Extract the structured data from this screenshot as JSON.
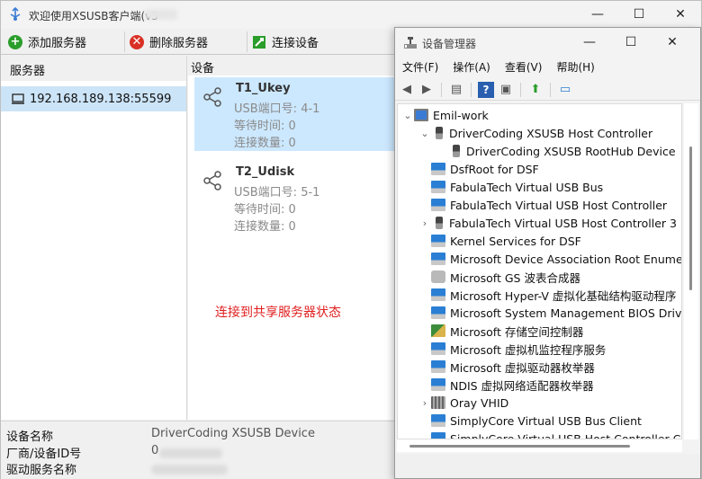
{
  "main": {
    "title": "欢迎使用XSUSB客户端(v3",
    "toolbar": {
      "add_server": "添加服务器",
      "delete_server": "删除服务器",
      "connect_device": "连接设备"
    },
    "servers_header": "服务器",
    "devices_header": "设备",
    "server_item": "192.168.189.138:55599",
    "devices": [
      {
        "name": "T1_Ukey",
        "port": "USB端口号: 4-1",
        "wait": "等待时间: 0",
        "count": "连接数量: 0"
      },
      {
        "name": "T2_Udisk",
        "port": "USB端口号: 5-1",
        "wait": "等待时间: 0",
        "count": "连接数量: 0"
      }
    ],
    "status_message": "连接到共享服务器状态",
    "info": {
      "device_name_label": "设备名称",
      "device_name_value": "DriverCoding XSUSB Device",
      "vendor_label": "厂商/设备ID号",
      "vendor_value": "0",
      "driver_label": "驱动服务名称"
    }
  },
  "devmgr": {
    "title": "设备管理器",
    "menus": [
      "文件(F)",
      "操作(A)",
      "查看(V)",
      "帮助(H)"
    ],
    "tree": [
      {
        "label": "Emil-work",
        "level": 0,
        "expander": "open",
        "icon": "computer-icon"
      },
      {
        "label": "DriverCoding XSUSB Host Controller",
        "level": 1,
        "expander": "open",
        "icon": "usb-plug-icon"
      },
      {
        "label": "DriverCoding XSUSB RootHub Device",
        "level": 2,
        "expander": "none",
        "icon": "usb-plug-icon"
      },
      {
        "label": "DsfRoot for DSF",
        "level": 1,
        "expander": "none",
        "icon": "system-device-icon"
      },
      {
        "label": "FabulaTech Virtual USB Bus",
        "level": 1,
        "expander": "none",
        "icon": "system-device-icon"
      },
      {
        "label": "FabulaTech Virtual USB Host Controller",
        "level": 1,
        "expander": "none",
        "icon": "system-device-icon"
      },
      {
        "label": "FabulaTech Virtual USB Host Controller 3",
        "level": 1,
        "expander": "closed",
        "icon": "usb-plug-icon"
      },
      {
        "label": "Kernel Services for DSF",
        "level": 1,
        "expander": "none",
        "icon": "system-device-icon"
      },
      {
        "label": "Microsoft Device Association Root Enumer",
        "level": 1,
        "expander": "none",
        "icon": "system-device-icon"
      },
      {
        "label": "Microsoft GS 波表合成器",
        "level": 1,
        "expander": "none",
        "icon": "audio-device-icon"
      },
      {
        "label": "Microsoft Hyper-V 虚拟化基础结构驱动程序",
        "level": 1,
        "expander": "none",
        "icon": "system-device-icon"
      },
      {
        "label": "Microsoft System Management BIOS Drive",
        "level": 1,
        "expander": "none",
        "icon": "system-device-icon"
      },
      {
        "label": "Microsoft 存储空间控制器",
        "level": 1,
        "expander": "none",
        "icon": "storage-controller-icon"
      },
      {
        "label": "Microsoft 虚拟机监控程序服务",
        "level": 1,
        "expander": "none",
        "icon": "system-device-icon"
      },
      {
        "label": "Microsoft 虚拟驱动器枚举器",
        "level": 1,
        "expander": "none",
        "icon": "system-device-icon"
      },
      {
        "label": "NDIS 虚拟网络适配器枚举器",
        "level": 1,
        "expander": "none",
        "icon": "system-device-icon"
      },
      {
        "label": "Oray VHID",
        "level": 1,
        "expander": "closed",
        "icon": "vhid-icon"
      },
      {
        "label": "SimplyCore Virtual USB Bus Client",
        "level": 1,
        "expander": "none",
        "icon": "system-device-icon"
      },
      {
        "label": "SimplyCore Virtual USB Host Controller Cli",
        "level": 1,
        "expander": "none",
        "icon": "system-device-icon"
      }
    ]
  },
  "colors": {
    "selection": "#cce8ff",
    "status_red": "#e02020",
    "add_green": "#2a9d2a",
    "delete_red": "#d93025"
  }
}
